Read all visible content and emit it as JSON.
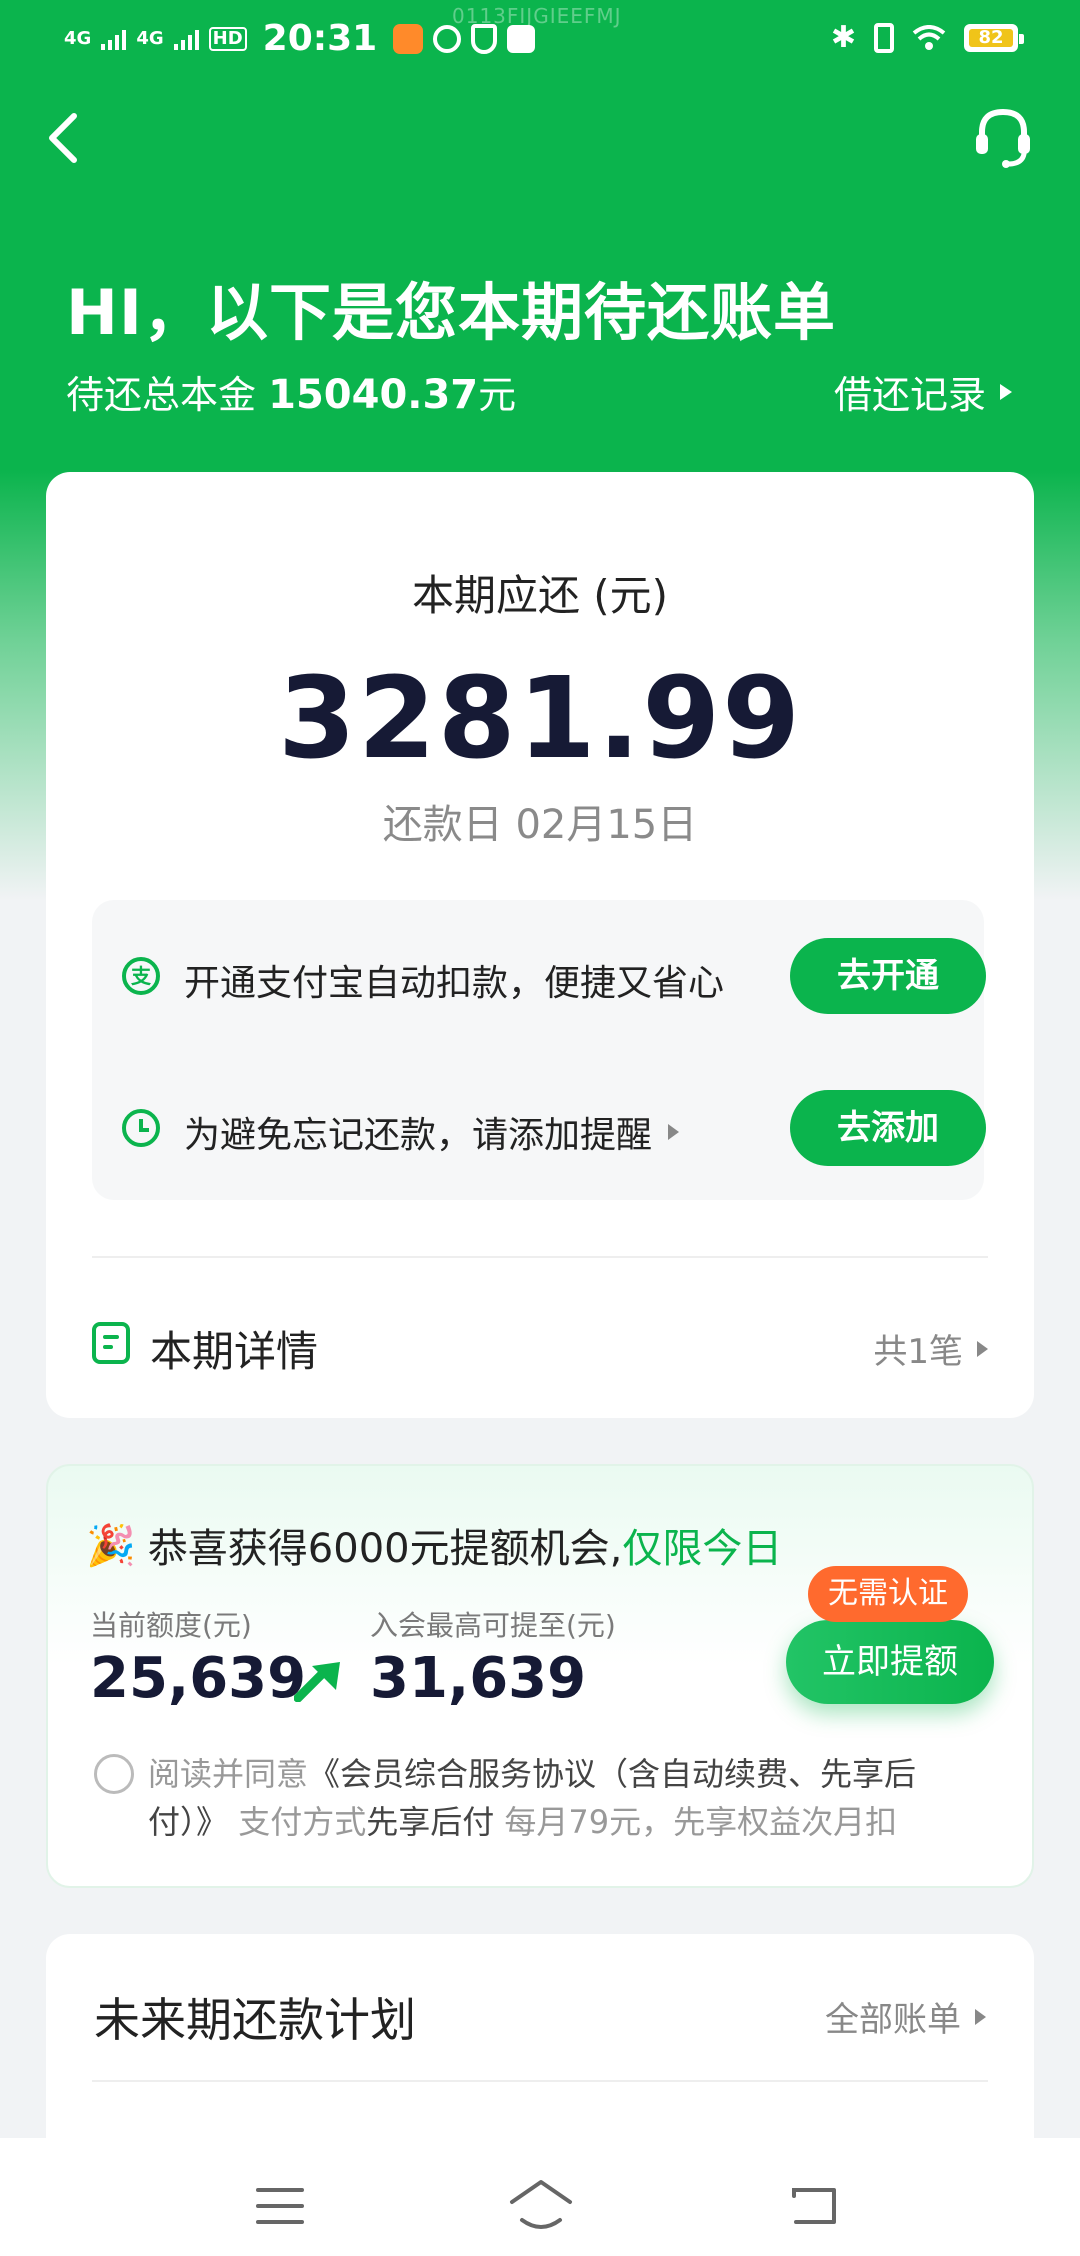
{
  "status_bar": {
    "network1": "4G",
    "network2": "4G",
    "hd": "HD",
    "time": "20:31",
    "device_id": "0113FIJGIEEFMJ",
    "battery": "82",
    "battery_color": "#f0c419"
  },
  "header": {
    "greeting": "HI，以下是您本期待还账单",
    "total_label": "待还总本金",
    "total_amount": "15040.37",
    "total_unit": "元",
    "history_link": "借还记录"
  },
  "bill": {
    "title": "本期应还 (元)",
    "amount": "3281.99",
    "due_label": "还款日",
    "due_date": "02月15日",
    "tips": [
      {
        "icon": "alipay-icon",
        "glyph": "支",
        "text": "开通支付宝自动扣款，便捷又省心",
        "button": "去开通"
      },
      {
        "icon": "clock-icon",
        "text": "为避免忘记还款，请添加提醒",
        "button": "去添加"
      }
    ],
    "detail_title": "本期详情",
    "detail_count": "共1笔"
  },
  "promo": {
    "headline": "恭喜获得6000元提额机会,",
    "headline_highlight": "仅限今日",
    "current_label": "当前额度(元)",
    "current_value": "25,639",
    "max_label": "入会最高可提至(元)",
    "max_value": "31,639",
    "badge": "无需认证",
    "button": "立即提额",
    "agree_prefix": "阅读并同意",
    "agree_link": "《会员综合服务协议（含自动续费、先享后付）》",
    "agree_pay_label": "支付方式",
    "agree_pay_value": "先享后付",
    "agree_suffix": "每月79元，先享权益次月扣"
  },
  "plan": {
    "title": "未来期还款计划",
    "link": "全部账单"
  },
  "colors": {
    "brand_green": "#0bb44d",
    "amount_dark": "#161a35",
    "badge_orange": "#ff6a2e"
  }
}
